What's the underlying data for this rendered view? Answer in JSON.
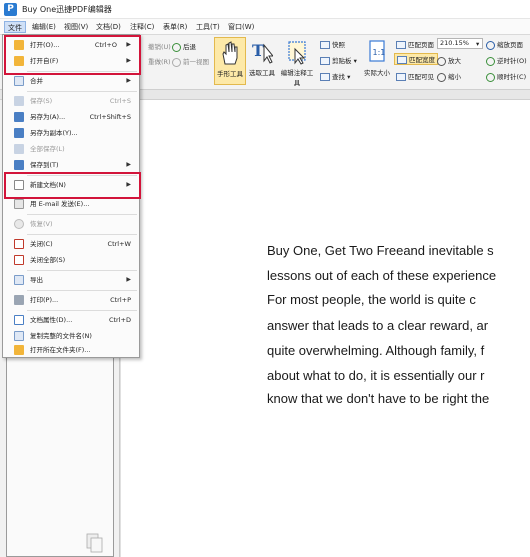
{
  "app": {
    "title": "Buy One迅捷PDF编辑器",
    "icon_letter": "P"
  },
  "menubar": [
    "文件",
    "编辑(E)",
    "视图(V)",
    "文档(D)",
    "注释(C)",
    "表单(R)",
    "工具(T)",
    "窗口(W)"
  ],
  "ribbon": {
    "undo": "撤销(U)",
    "redo": "重做(R)",
    "back": "后退",
    "forward": "前一视图",
    "hand_tool": "手形工具",
    "select_tool": "选取工具",
    "edit_annotation_tool": "编辑注释工具",
    "snapshot": "快照",
    "clipboard": "剪贴板",
    "find": "查找",
    "actual_size": "实际大小",
    "fit_page": "匹配页面",
    "fit_width": "匹配宽度",
    "fit_visible": "匹配可见",
    "zoom_value": "210.15%",
    "zoom_in": "放大",
    "zoom_out": "缩小",
    "zoom_in_out": "缩放页面",
    "rotate_ccw": "逆时针(O)",
    "rotate_cw": "顺时针(C)"
  },
  "file_menu": {
    "open": "打开(O)...",
    "open_shortcut": "Ctrl+O",
    "open_recent": "打开自(F)",
    "combine": "合并",
    "save": "保存(S)",
    "save_shortcut": "Ctrl+S",
    "save_as": "另存为(A)...",
    "save_as_shortcut": "Ctrl+Shift+S",
    "save_copy": "另存为副本(Y)...",
    "save_all": "全部保存(L)",
    "save_to": "保存到(T)",
    "new_document": "新建文档(N)",
    "email": "用 E-mail 发送(E)...",
    "revert": "恢复(V)",
    "close": "关闭(C)",
    "close_shortcut": "Ctrl+W",
    "close_all": "关闭全部(S)",
    "export": "导出",
    "print": "打印(P)...",
    "print_shortcut": "Ctrl+P",
    "doc_properties": "文档属性(D)...",
    "doc_properties_shortcut": "Ctrl+D",
    "copy_full_filename": "复制完整的文件名(N)",
    "open_in_folder": "打开所在文件夹(F)..."
  },
  "document": {
    "lines": [
      "Buy One, Get Two Freeand inevitable s",
      "lessons out of each of these experience",
      "For most people, the world is quite c",
      "answer that leads to a clear reward, ar",
      "quite overwhelming. Although family, f",
      "about what to do, it is essentially our r",
      "know that we don't have to be right the"
    ]
  },
  "colors": {
    "highlight": "#d2143a",
    "active_tool": "#fde9a8",
    "menu_active": "#cfe0f7"
  }
}
